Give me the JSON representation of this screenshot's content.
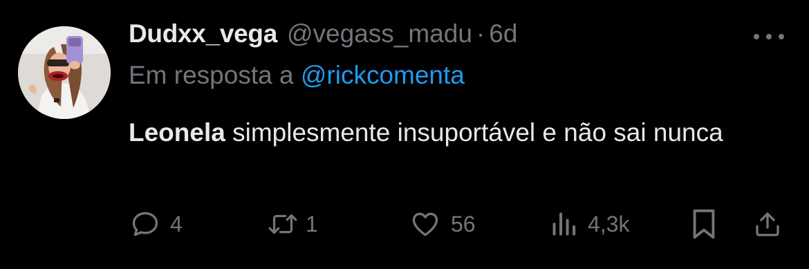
{
  "tweet": {
    "display_name": "Dudxx_vega",
    "handle": "@vegass_madu",
    "separator": "·",
    "time": "6d",
    "reply_prefix": "Em resposta a",
    "reply_mention": "@rickcomenta",
    "text_bold": "Leonela",
    "text_rest": " simplesmente insuportável e não sai nunca"
  },
  "actions": {
    "replies": "4",
    "retweets": "1",
    "likes": "56",
    "views": "4,3k"
  },
  "colors": {
    "background": "#000000",
    "primary_text": "#e7e9ea",
    "secondary_text": "#71767b",
    "link": "#1d9bf0"
  },
  "icons": {
    "more": "more-horizontal-icon",
    "reply": "reply-bubble-icon",
    "retweet": "retweet-icon",
    "like": "heart-icon",
    "views": "views-chart-icon",
    "bookmark": "bookmark-icon",
    "share": "share-icon"
  }
}
